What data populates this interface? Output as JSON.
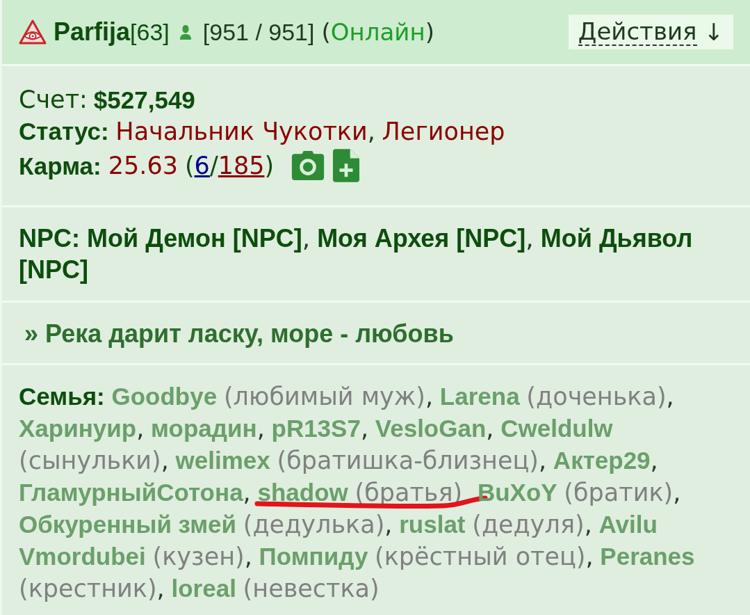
{
  "header": {
    "name": "Parfija",
    "level": "[63]",
    "health": "[951 / 951]",
    "presence": {
      "open": "(",
      "label": "Онлайн",
      "close": ")"
    },
    "actions": {
      "label": "Действия",
      "arrow": "↓"
    }
  },
  "account": {
    "label": "Счет:",
    "value": "$527,549"
  },
  "status": {
    "label": "Статус:",
    "titles": [
      {
        "text": "Начальник Чукотки",
        "sep": ","
      },
      {
        "text": "Легионер"
      }
    ]
  },
  "karma": {
    "label": "Карма:",
    "value": "25.63",
    "open": "(",
    "up": "6",
    "slash": "/",
    "down": "185",
    "close": ")"
  },
  "npc": {
    "label": "NPC:",
    "items": [
      {
        "name": "Мой Демон",
        "tag": "[NPC]",
        "sep": ","
      },
      {
        "name": "Моя Архея",
        "tag": "[NPC]",
        "sep": ","
      },
      {
        "name": "Мой Дьявол",
        "tag": "[NPC]"
      }
    ]
  },
  "motto": "» Река дарит ласку, море - любовь",
  "family": {
    "label": "Семья:",
    "members": [
      {
        "name": "Goodbye",
        "relation": "(любимый муж)",
        "sep": ",",
        "marked": false
      },
      {
        "name": "Larena",
        "relation": "(доченька)",
        "sep": ",",
        "marked": false
      },
      {
        "name": "Харинуир",
        "sep": ",",
        "marked": false
      },
      {
        "name": "морадин",
        "sep": ",",
        "marked": false
      },
      {
        "name": "pR13S7",
        "sep": ",",
        "marked": false
      },
      {
        "name": "VesloGan",
        "sep": ",",
        "marked": false
      },
      {
        "name": "Cweldulw",
        "relation": "(сынульки)",
        "sep": ",",
        "marked": false
      },
      {
        "name": "welimex",
        "relation": "(братишка-близнец)",
        "sep": ",",
        "marked": false
      },
      {
        "name": "Актер29",
        "sep": ",",
        "marked": false
      },
      {
        "name": "ГламурныйСотона",
        "sep": ",",
        "marked": false
      },
      {
        "name": "shadow",
        "relation": "(братья)",
        "marked": true
      },
      {
        "name": "BuXoY",
        "relation": "(братик)",
        "sep": ",",
        "marked": false
      },
      {
        "name": "Обкуренный змей",
        "relation": "(дедулька)",
        "sep": ",",
        "marked": false
      },
      {
        "name": "ruslat",
        "relation": "(дедуля)",
        "sep": ",",
        "marked": false
      },
      {
        "name": [
          "Avilu",
          "Vmordubei"
        ],
        "relation": "(кузен)",
        "sep": ",",
        "marked": false
      },
      {
        "name": "Помпиду",
        "relation": "(крёстный отец)",
        "sep": ",",
        "marked": false
      },
      {
        "name": "Peranes",
        "relation": "(крестник)",
        "sep": ",",
        "marked": false
      },
      {
        "name": "loreal",
        "relation": "(невестка)",
        "marked": false
      }
    ]
  }
}
